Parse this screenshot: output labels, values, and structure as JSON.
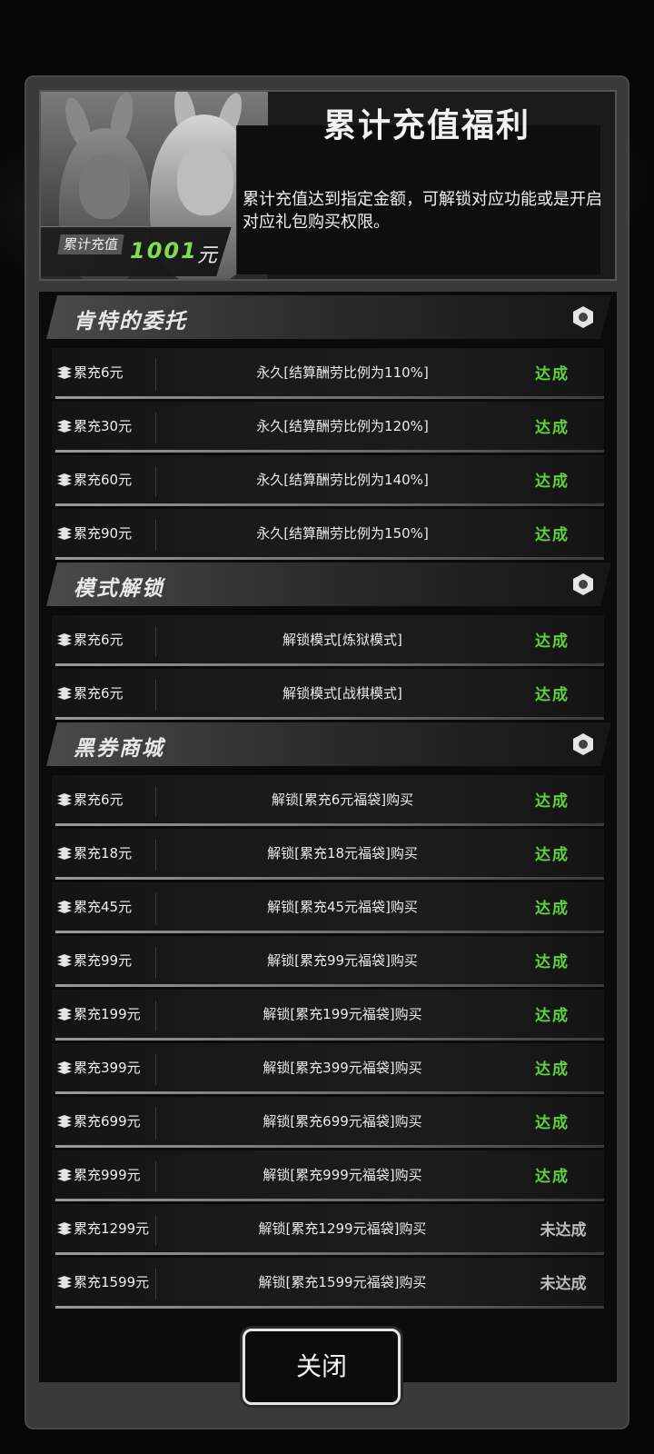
{
  "header": {
    "title": "累计充值福利",
    "description": "累计充值达到指定金额，可解锁对应功能或是开启对应礼包购买权限。",
    "total_label": "累计充值",
    "total_value": "1001",
    "total_unit": "元"
  },
  "sections": [
    {
      "title": "肯特的委托",
      "rows": [
        {
          "req": "累充6元",
          "reward": "永久[结算酬劳比例为110%]",
          "status": "达成"
        },
        {
          "req": "累充30元",
          "reward": "永久[结算酬劳比例为120%]",
          "status": "达成"
        },
        {
          "req": "累充60元",
          "reward": "永久[结算酬劳比例为140%]",
          "status": "达成"
        },
        {
          "req": "累充90元",
          "reward": "永久[结算酬劳比例为150%]",
          "status": "达成"
        }
      ]
    },
    {
      "title": "模式解锁",
      "rows": [
        {
          "req": "累充6元",
          "reward": "解锁模式[炼狱模式]",
          "status": "达成"
        },
        {
          "req": "累充6元",
          "reward": "解锁模式[战棋模式]",
          "status": "达成"
        }
      ]
    },
    {
      "title": "黑券商城",
      "rows": [
        {
          "req": "累充6元",
          "reward": "解锁[累充6元福袋]购买",
          "status": "达成"
        },
        {
          "req": "累充18元",
          "reward": "解锁[累充18元福袋]购买",
          "status": "达成"
        },
        {
          "req": "累充45元",
          "reward": "解锁[累充45元福袋]购买",
          "status": "达成"
        },
        {
          "req": "累充99元",
          "reward": "解锁[累充99元福袋]购买",
          "status": "达成"
        },
        {
          "req": "累充199元",
          "reward": "解锁[累充199元福袋]购买",
          "status": "达成"
        },
        {
          "req": "累充399元",
          "reward": "解锁[累充399元福袋]购买",
          "status": "达成"
        },
        {
          "req": "累充699元",
          "reward": "解锁[累充699元福袋]购买",
          "status": "达成"
        },
        {
          "req": "累充999元",
          "reward": "解锁[累充999元福袋]购买",
          "status": "达成"
        },
        {
          "req": "累充1299元",
          "reward": "解锁[累充1299元福袋]购买",
          "status": "未达成"
        },
        {
          "req": "累充1599元",
          "reward": "解锁[累充1599元福袋]购买",
          "status": "未达成"
        }
      ]
    }
  ],
  "close_label": "关闭",
  "colors": {
    "achieved": "#5ed23c",
    "not_achieved": "#bdbdbd"
  }
}
